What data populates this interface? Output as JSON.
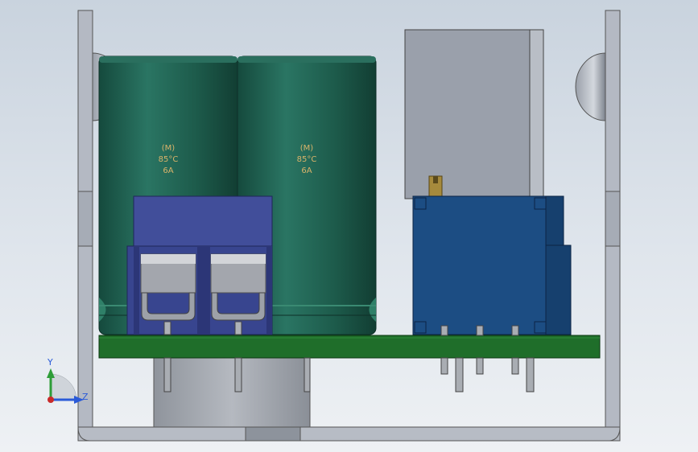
{
  "capacitors": [
    {
      "brand": "(M)",
      "temp": "85°C",
      "rating": "6A"
    },
    {
      "brand": "(M)",
      "temp": "85°C",
      "rating": "6A"
    }
  ],
  "axes": {
    "y_label": "Y",
    "z_label": "Z"
  },
  "colors": {
    "background_top": "#c9d3de",
    "capacitor": "#1f5e4e",
    "terminal_block": "#414e9a",
    "relay": "#1c4d83",
    "pcb": "#1f6e2a",
    "enclosure": "#b7bcc6",
    "label": "#d9b36a"
  }
}
